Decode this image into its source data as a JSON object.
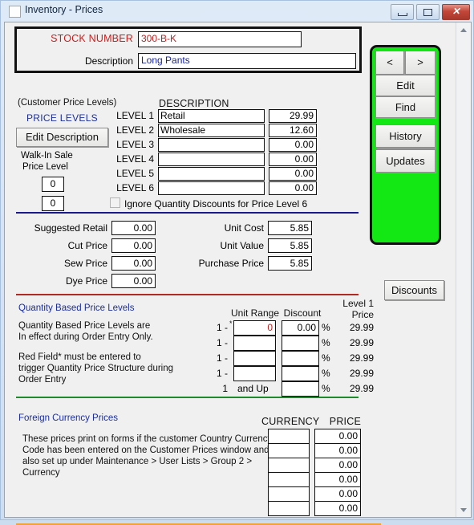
{
  "window": {
    "title": "Inventory - Prices",
    "icon": "window-icon",
    "controls": {
      "minimize": "minimize-icon",
      "maximize": "maximize-icon",
      "close": "close-icon"
    }
  },
  "header": {
    "stock_number_label": "STOCK NUMBER",
    "stock_number_value": "300-B-K",
    "description_label": "Description",
    "description_value": "Long Pants"
  },
  "price_levels": {
    "customer_note": "(Customer Price Levels)",
    "section_label": "PRICE LEVELS",
    "edit_description_button": "Edit Description",
    "walk_in_line1": "Walk-In Sale",
    "walk_in_line2": "Price Level",
    "walk_in_value_1": "0",
    "walk_in_value_2": "0",
    "description_header": "DESCRIPTION",
    "rows": [
      {
        "label": "LEVEL 1",
        "description": "Retail",
        "price": "29.99"
      },
      {
        "label": "LEVEL 2",
        "description": "Wholesale",
        "price": "12.60"
      },
      {
        "label": "LEVEL 3",
        "description": "",
        "price": "0.00"
      },
      {
        "label": "LEVEL 4",
        "description": "",
        "price": "0.00"
      },
      {
        "label": "LEVEL 5",
        "description": "",
        "price": "0.00"
      },
      {
        "label": "LEVEL 6",
        "description": "",
        "price": "0.00"
      }
    ],
    "ignore_checkbox_label": "Ignore Quantity Discounts for Price Level 6",
    "ignore_checkbox_checked": false
  },
  "costs": {
    "left": [
      {
        "label": "Suggested Retail",
        "value": "0.00"
      },
      {
        "label": "Cut Price",
        "value": "0.00"
      },
      {
        "label": "Sew Price",
        "value": "0.00"
      },
      {
        "label": "Dye Price",
        "value": "0.00"
      }
    ],
    "right": [
      {
        "label": "Unit Cost",
        "value": "5.85"
      },
      {
        "label": "Unit Value",
        "value": "5.85"
      },
      {
        "label": "Purchase Price",
        "value": "5.85"
      }
    ]
  },
  "quantity": {
    "title": "Quantity Based Price Levels",
    "note_line1": "Quantity Based Price Levels are",
    "note_line2": "In effect during Order Entry Only.",
    "note_line3": "Red Field* must be entered to",
    "note_line4": "trigger Quantity Price Structure during",
    "note_line5": "Order Entry",
    "header_unit_range": "Unit Range",
    "header_discount": "Discount",
    "header_level1_line1": "Level 1",
    "header_level1_line2": "Price",
    "percent_symbol": "%",
    "and_up_label": "and Up",
    "rows": [
      {
        "prefix": "1 -",
        "star": "*",
        "unit_range": "0",
        "discount": "0.00",
        "level1_price": "29.99"
      },
      {
        "prefix": "1 -",
        "star": "",
        "unit_range": "",
        "discount": "",
        "level1_price": "29.99"
      },
      {
        "prefix": "1 -",
        "star": "",
        "unit_range": "",
        "discount": "",
        "level1_price": "29.99"
      },
      {
        "prefix": "1 -",
        "star": "",
        "unit_range": "",
        "discount": "",
        "level1_price": "29.99"
      },
      {
        "prefix": "1",
        "star": "",
        "unit_range": "",
        "discount": "",
        "level1_price": "29.99"
      }
    ]
  },
  "currency": {
    "title": "Foreign Currency Prices",
    "note_line1": "These prices print on forms if the customer Country Currency",
    "note_line2": "Code has been entered on the Customer Prices window and",
    "note_line3": "also set up under Maintenance > User Lists > Group 2 >",
    "note_line4": "Currency",
    "header_currency": "CURRENCY",
    "header_price": "PRICE",
    "rows": [
      {
        "currency": "",
        "price": "0.00"
      },
      {
        "currency": "",
        "price": "0.00"
      },
      {
        "currency": "",
        "price": "0.00"
      },
      {
        "currency": "",
        "price": "0.00"
      },
      {
        "currency": "",
        "price": "0.00"
      },
      {
        "currency": "",
        "price": "0.00"
      }
    ]
  },
  "actions": {
    "prev": "<",
    "next": ">",
    "edit": "Edit",
    "find": "Find",
    "history": "History",
    "updates": "Updates",
    "discounts": "Discounts"
  },
  "colors": {
    "panel_green": "#14e814",
    "stock_label_red": "#cc1e1e",
    "section_blue": "#1d2f9e",
    "rule_navy": "#1a1a8c",
    "rule_red": "#b02a24",
    "rule_green": "#1f8a2b",
    "rule_orange": "#f0a33c"
  }
}
